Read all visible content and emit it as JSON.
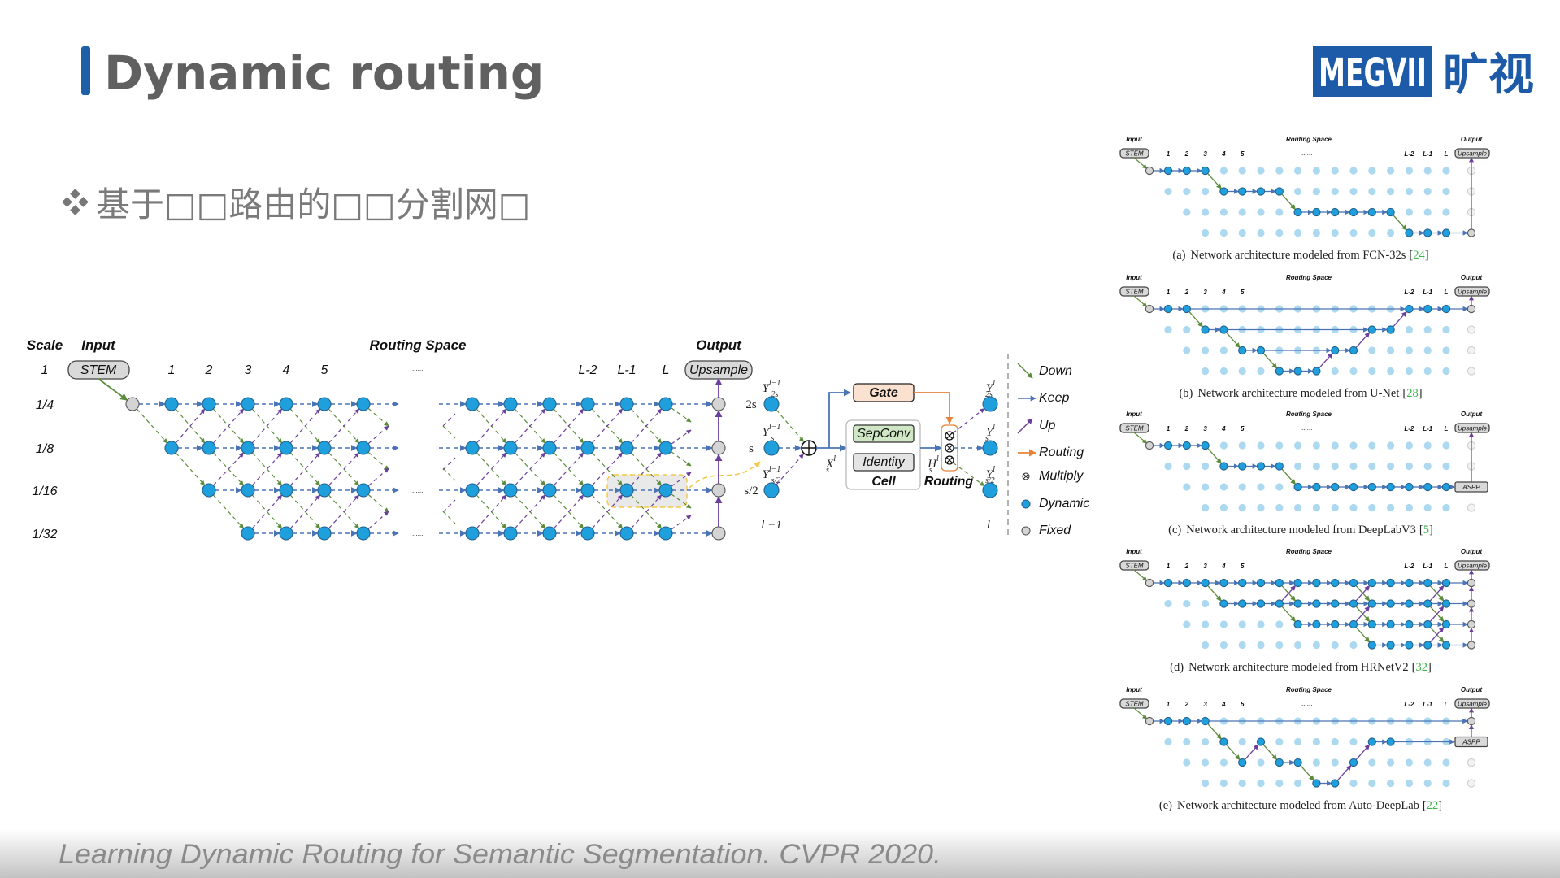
{
  "slide": {
    "title": "Dynamic routing",
    "bullet_icon": "diamond-cluster-icon",
    "bullet": "基于□□路由的□□分割网□",
    "footer": "Learning Dynamic Routing for Semantic Segmentation. CVPR 2020.",
    "accent": "#1f5fa8"
  },
  "logo": {
    "text": "MEGVII",
    "cn": "旷视",
    "color": "#1d5aa8"
  },
  "colors": {
    "dynamic": "#1fa0dc",
    "dynamic_inactive": "#acd9ef",
    "fixed": "#d4d4d4",
    "down": "#5b8c3a",
    "keep": "#4b74b6",
    "up": "#6a3f9c",
    "routing": "#e8843a",
    "highlight": "#f2c94c"
  },
  "main_diagram": {
    "headers": {
      "scale": "Scale",
      "input": "Input",
      "routing_space": "Routing Space",
      "output": "Output"
    },
    "scales": [
      "1",
      "1/4",
      "1/8",
      "1/16",
      "1/32"
    ],
    "stem": "STEM",
    "upsample": "Upsample",
    "layers_left": [
      "1",
      "2",
      "3",
      "4",
      "5"
    ],
    "ellipsis": "......",
    "layers_right": [
      "L-2",
      "L-1",
      "L"
    ]
  },
  "cell": {
    "left_scales": [
      "2s",
      "s",
      "s/2"
    ],
    "left_inputs": [
      {
        "base": "Y",
        "sup": "l−1",
        "sub": "2s"
      },
      {
        "base": "Y",
        "sup": "l−1",
        "sub": "s"
      },
      {
        "base": "Y",
        "sup": "l−1",
        "sub": "s/2"
      }
    ],
    "right_outputs": [
      {
        "base": "Y",
        "sup": "l",
        "sub": "2s"
      },
      {
        "base": "Y",
        "sup": "l",
        "sub": "s"
      },
      {
        "base": "Y",
        "sup": "l",
        "sub": "s/2"
      }
    ],
    "x_label": {
      "base": "X",
      "sup": "l",
      "sub": "s"
    },
    "h_label": {
      "base": "H",
      "sup": "l",
      "sub": "s"
    },
    "gate": "Gate",
    "sepconv": "SepConv",
    "identity": "Identity",
    "cell_label": "Cell",
    "routing_label": "Routing",
    "layer_prev": "l −1",
    "layer_cur": "l"
  },
  "legend": [
    {
      "label": "Down",
      "icon": "down-arrow-icon"
    },
    {
      "label": "Keep",
      "icon": "keep-arrow-icon"
    },
    {
      "label": "Up",
      "icon": "up-arrow-icon"
    },
    {
      "label": "Routing",
      "icon": "routing-arrow-icon"
    },
    {
      "label": "Multiply",
      "icon": "multiply-icon"
    },
    {
      "label": "Dynamic",
      "icon": "dynamic-node-icon"
    },
    {
      "label": "Fixed",
      "icon": "fixed-node-icon"
    }
  ],
  "panels_common": {
    "input": "Input",
    "routing_space": "Routing Space",
    "output": "Output",
    "stem": "STEM",
    "upsample": "Upsample",
    "aspp": "ASPP",
    "layers_left": [
      "1",
      "2",
      "3",
      "4",
      "5"
    ],
    "ellipsis": "......",
    "layers_right": [
      "L-2",
      "L-1",
      "L"
    ]
  },
  "panels": [
    {
      "letter": "(a)",
      "caption": "Network architecture modeled from FCN-32s",
      "ref": "24",
      "path": [
        [
          0,
          0
        ],
        [
          1,
          0
        ],
        [
          2,
          0
        ],
        [
          3,
          1
        ],
        [
          4,
          1
        ],
        [
          5,
          1
        ],
        [
          6,
          1
        ],
        [
          7,
          2
        ],
        [
          8,
          2
        ],
        [
          9,
          2
        ],
        [
          10,
          2
        ],
        [
          11,
          2
        ],
        [
          12,
          2
        ],
        [
          13,
          3
        ],
        [
          14,
          3
        ],
        [
          15,
          3
        ]
      ],
      "extra": [],
      "output_row": 3,
      "aspp": false
    },
    {
      "letter": "(b)",
      "caption": "Network architecture modeled from U-Net",
      "ref": "28",
      "path": [
        [
          0,
          0
        ],
        [
          1,
          0
        ],
        [
          2,
          1
        ],
        [
          3,
          1
        ],
        [
          4,
          2
        ],
        [
          5,
          2
        ],
        [
          6,
          3
        ],
        [
          7,
          3
        ],
        [
          8,
          3
        ],
        [
          9,
          2
        ],
        [
          10,
          2
        ],
        [
          11,
          1
        ],
        [
          12,
          1
        ],
        [
          13,
          0
        ],
        [
          14,
          0
        ],
        [
          15,
          0
        ]
      ],
      "extra": [
        [
          [
            1,
            0
          ],
          [
            13,
            0
          ]
        ],
        [
          [
            3,
            1
          ],
          [
            11,
            1
          ]
        ],
        [
          [
            5,
            2
          ],
          [
            9,
            2
          ]
        ]
      ],
      "output_row": 0,
      "aspp": false
    },
    {
      "letter": "(c)",
      "caption": "Network architecture modeled from DeepLabV3",
      "ref": "5",
      "path": [
        [
          0,
          0
        ],
        [
          1,
          0
        ],
        [
          2,
          0
        ],
        [
          3,
          1
        ],
        [
          4,
          1
        ],
        [
          5,
          1
        ],
        [
          6,
          1
        ],
        [
          7,
          2
        ],
        [
          8,
          2
        ],
        [
          9,
          2
        ],
        [
          10,
          2
        ],
        [
          11,
          2
        ],
        [
          12,
          2
        ],
        [
          13,
          2
        ],
        [
          14,
          2
        ],
        [
          15,
          2
        ]
      ],
      "extra": [],
      "output_row": 2,
      "aspp": true
    },
    {
      "letter": "(d)",
      "caption": "Network architecture modeled from HRNetV2",
      "ref": "32",
      "hrnet": true,
      "output_row": 0,
      "aspp": false,
      "path": [],
      "extra": []
    },
    {
      "letter": "(e)",
      "caption": "Network architecture modeled from Auto-DeepLab",
      "ref": "22",
      "path": [
        [
          0,
          0
        ],
        [
          1,
          0
        ],
        [
          2,
          0
        ],
        [
          3,
          1
        ],
        [
          4,
          2
        ],
        [
          5,
          1
        ],
        [
          6,
          2
        ],
        [
          7,
          2
        ],
        [
          8,
          3
        ],
        [
          9,
          3
        ],
        [
          10,
          2
        ],
        [
          11,
          1
        ],
        [
          12,
          1
        ]
      ],
      "extra": [
        [
          [
            2,
            0
          ],
          [
            16,
            0
          ]
        ]
      ],
      "output_row": 1,
      "aspp": true
    }
  ]
}
